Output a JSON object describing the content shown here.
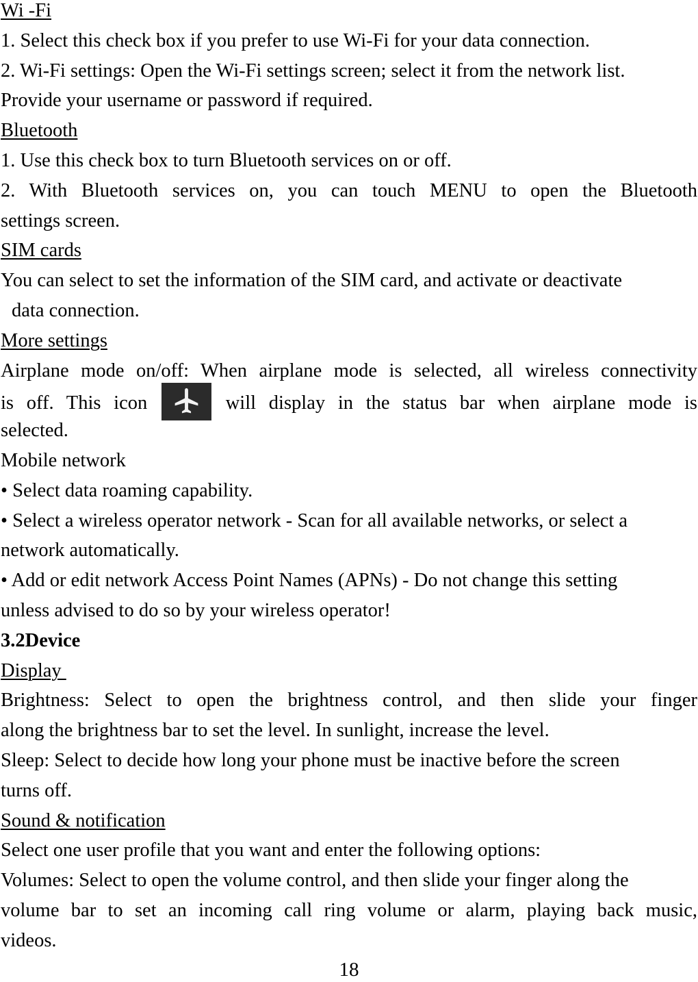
{
  "wifi": {
    "heading": "Wi -Fi",
    "line1": "1. Select this check box if you prefer to use Wi-Fi for your data connection.",
    "line2": "2. Wi-Fi settings: Open the Wi-Fi settings screen; select it from the network list.",
    "line3": "Provide your username or password if required."
  },
  "bluetooth": {
    "heading": "Bluetooth",
    "line1": "1. Use this check box to turn Bluetooth services on or off.",
    "line2a": "2. With Bluetooth services on, you can touch MENU to open the Bluetooth",
    "line2b": "settings screen."
  },
  "sim": {
    "heading": "SIM cards",
    "line1": "You can select to set the information of the SIM card, and activate or deactivate",
    "line2": "data connection."
  },
  "more": {
    "heading": "More settings",
    "airplane_a": "Airplane mode on/off: When airplane mode is selected, all wireless connectivity",
    "airplane_b1": "is off. This icon",
    "airplane_b2": "will display in the status bar when airplane mode is",
    "airplane_c": "selected.",
    "icon": "airplane-icon",
    "mobile_heading": "Mobile network",
    "bullet1": "• Select data roaming capability.",
    "bullet2a": "• Select a wireless operator network - Scan for all available networks, or select a",
    "bullet2b": "network automatically.",
    "bullet3a": "• Add or edit network Access Point Names (APNs) - Do not change this setting",
    "bullet3b": "unless advised to do so by your wireless operator!"
  },
  "device": {
    "section_title": "3.2Device",
    "display_heading": "Display ",
    "brightness_a": "Brightness: Select to open the brightness control, and then slide your finger",
    "brightness_b": "along the brightness bar to set the level. In sunlight, increase the level.",
    "sleep_a": "Sleep: Select to decide how long your phone must be inactive before the screen",
    "sleep_b": "turns off.",
    "sound_heading": "Sound & notification",
    "sound_line": "Select one user profile that you want and enter the following options:",
    "volumes_a": "Volumes: Select to open the volume control, and then slide your finger along the",
    "volumes_b": "volume bar to set an incoming call ring volume or alarm, playing back music,",
    "volumes_c": "videos."
  },
  "footer": {
    "page_number": "18"
  }
}
